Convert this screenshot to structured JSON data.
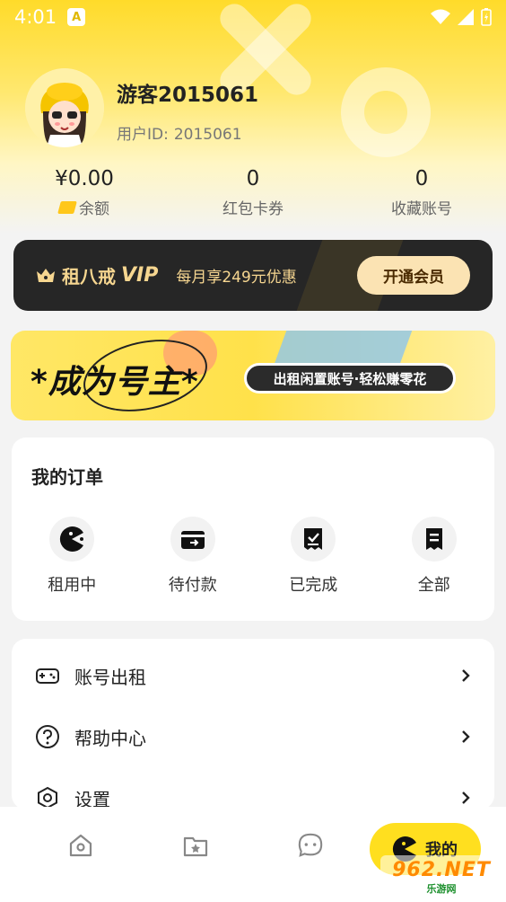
{
  "status_bar": {
    "time": "4:01",
    "badge": "A"
  },
  "profile": {
    "name": "游客2015061",
    "id_label": "用户ID:",
    "id_value": "2015061"
  },
  "stats": [
    {
      "value": "¥0.00",
      "label": "余额"
    },
    {
      "value": "0",
      "label": "红包卡券"
    },
    {
      "value": "0",
      "label": "收藏账号"
    }
  ],
  "vip": {
    "brand": "租八戒",
    "brand_vip": "VIP",
    "offer": "每月享249元优惠",
    "button": "开通会员"
  },
  "owner_banner": {
    "title": "*成为号主*",
    "tagline": "出租闲置账号·轻松赚零花"
  },
  "orders": {
    "title": "我的订单",
    "items": [
      {
        "label": "租用中",
        "icon": "pacman-icon"
      },
      {
        "label": "待付款",
        "icon": "wallet-icon"
      },
      {
        "label": "已完成",
        "icon": "receipt-check-icon"
      },
      {
        "label": "全部",
        "icon": "document-icon"
      }
    ]
  },
  "menu": {
    "items": [
      {
        "label": "账号出租",
        "icon": "gamepad-icon"
      },
      {
        "label": "帮助中心",
        "icon": "help-icon"
      },
      {
        "label": "设置",
        "icon": "settings-icon"
      }
    ]
  },
  "tabbar": {
    "tabs": [
      {
        "icon": "home-icon"
      },
      {
        "icon": "favorites-icon"
      },
      {
        "icon": "chat-icon"
      }
    ],
    "active_label": "我的"
  },
  "watermark": {
    "main": "962.NET",
    "sub": "乐游网"
  },
  "colors": {
    "accent": "#ffdf1f",
    "vip_bg": "#262626",
    "vip_gold": "#f6d690"
  }
}
